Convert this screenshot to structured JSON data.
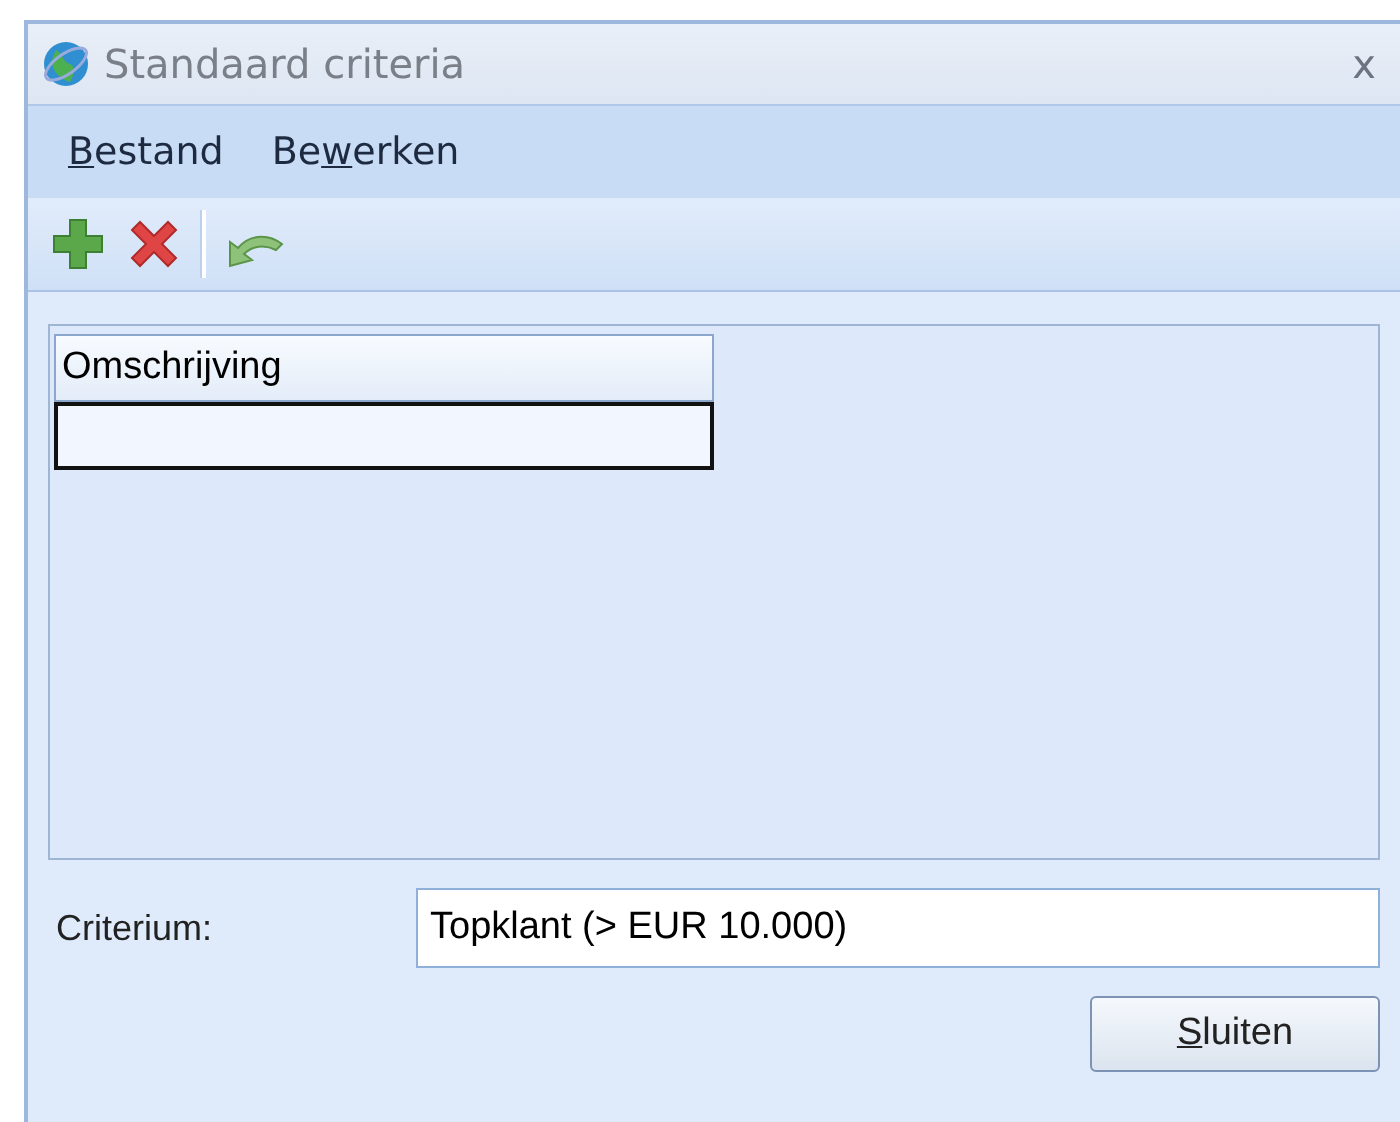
{
  "window": {
    "title": "Standaard criteria",
    "close": "x"
  },
  "menu": [
    {
      "key": "B",
      "after": "estand"
    },
    {
      "before": "Be",
      "key": "w",
      "after": "erken"
    }
  ],
  "toolbar": [
    {
      "kind": "add"
    },
    {
      "kind": "delete"
    },
    {
      "kind": "separator"
    },
    {
      "kind": "undo"
    }
  ],
  "table": {
    "columns": [
      "Omschrijving"
    ],
    "rows": [
      {
        "selected": true
      }
    ]
  },
  "criterium": {
    "label": "Criterium:",
    "value": "Topklant (> EUR 10.000)"
  },
  "buttons": [
    {
      "key": "S",
      "after": "luiten"
    }
  ]
}
